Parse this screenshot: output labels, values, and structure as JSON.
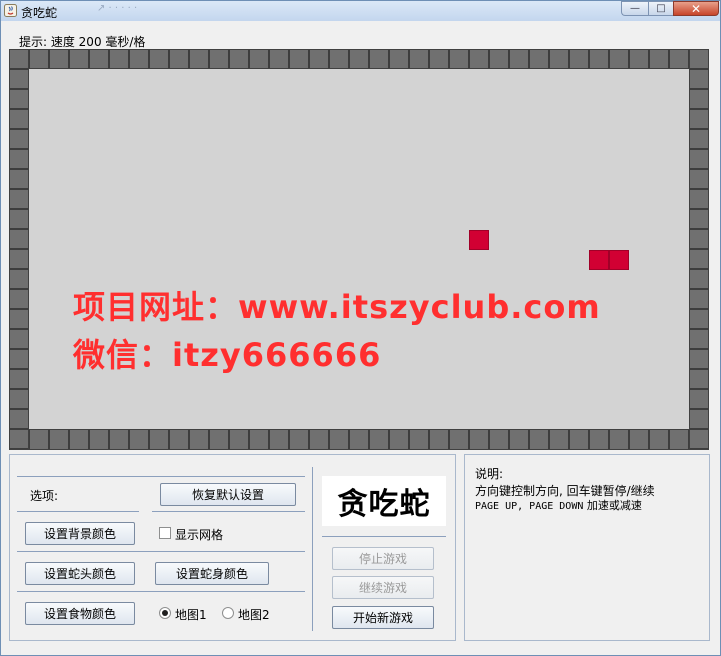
{
  "window": {
    "title": "贪吃蛇",
    "background_title_ghost": "↗  ·  ·  ·  ·  ·",
    "minimize_glyph": "—",
    "maximize_glyph": "□",
    "close_glyph": "✕"
  },
  "status": {
    "hint": "提示: 速度 200 毫秒/格"
  },
  "board": {
    "background_color": "#d3d3d3",
    "wall_color": "#707070",
    "snake_color": "#d10033",
    "food_color": "#d10033",
    "watermark_line1": "项目网址：www.itszyclub.com",
    "watermark_line2": "微信：itzy666666",
    "watermark_color": "#ff2f2f"
  },
  "options": {
    "label": "选项:",
    "restore_defaults": "恢复默认设置",
    "set_background_color": "设置背景颜色",
    "show_grid": "显示网格",
    "show_grid_checked": false,
    "set_head_color": "设置蛇头颜色",
    "set_body_color": "设置蛇身颜色",
    "set_food_color": "设置食物颜色",
    "map1": "地图1",
    "map2": "地图2",
    "selected_map": "地图1"
  },
  "game": {
    "logo": "贪吃蛇",
    "stop": "停止游戏",
    "resume": "继续游戏",
    "new_game": "开始新游戏"
  },
  "help": {
    "title": "说明:",
    "line1": "方向键控制方向, 回车键暂停/继续",
    "line2_keys": "PAGE UP, PAGE DOWN",
    "line2_text": " 加速或减速"
  }
}
